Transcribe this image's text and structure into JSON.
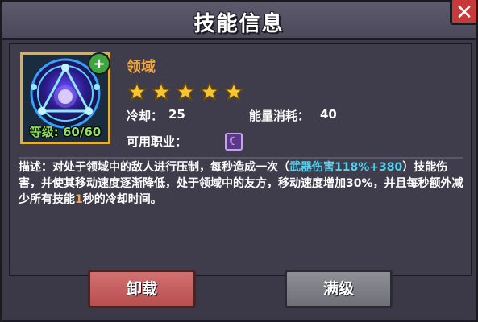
{
  "window": {
    "title": "技能信息",
    "close_symbol": "✕"
  },
  "skill": {
    "name": "领域",
    "stars": 5,
    "level_text": "等级: 60/60",
    "cooldown_label": "冷却：",
    "cooldown_value": "25",
    "energy_label": "能量消耗：",
    "energy_value": "40",
    "profession_label": "可用职业：",
    "profession_icon": "mage-hat-icon",
    "upgrade_badge": "+"
  },
  "description": {
    "prefix": "描述：对处于领域中的敌人进行压制，每秒造成一次（",
    "damage_formula": "武器伤害118%+380",
    "middle": "）技能伤害，并使其移动速度逐渐降低，处于领域中的友方，移动速度增加30%，并且每秒额外减少所有技能",
    "reduce_seconds": "1",
    "suffix": "秒的冷却时间。"
  },
  "buttons": {
    "unload_label": "卸载",
    "max_label": "满级"
  },
  "colors": {
    "skill_name": "#f3a63a",
    "formula_highlight": "#4fd4f0",
    "level_text": "#8fe060",
    "star": "#f7c531"
  }
}
